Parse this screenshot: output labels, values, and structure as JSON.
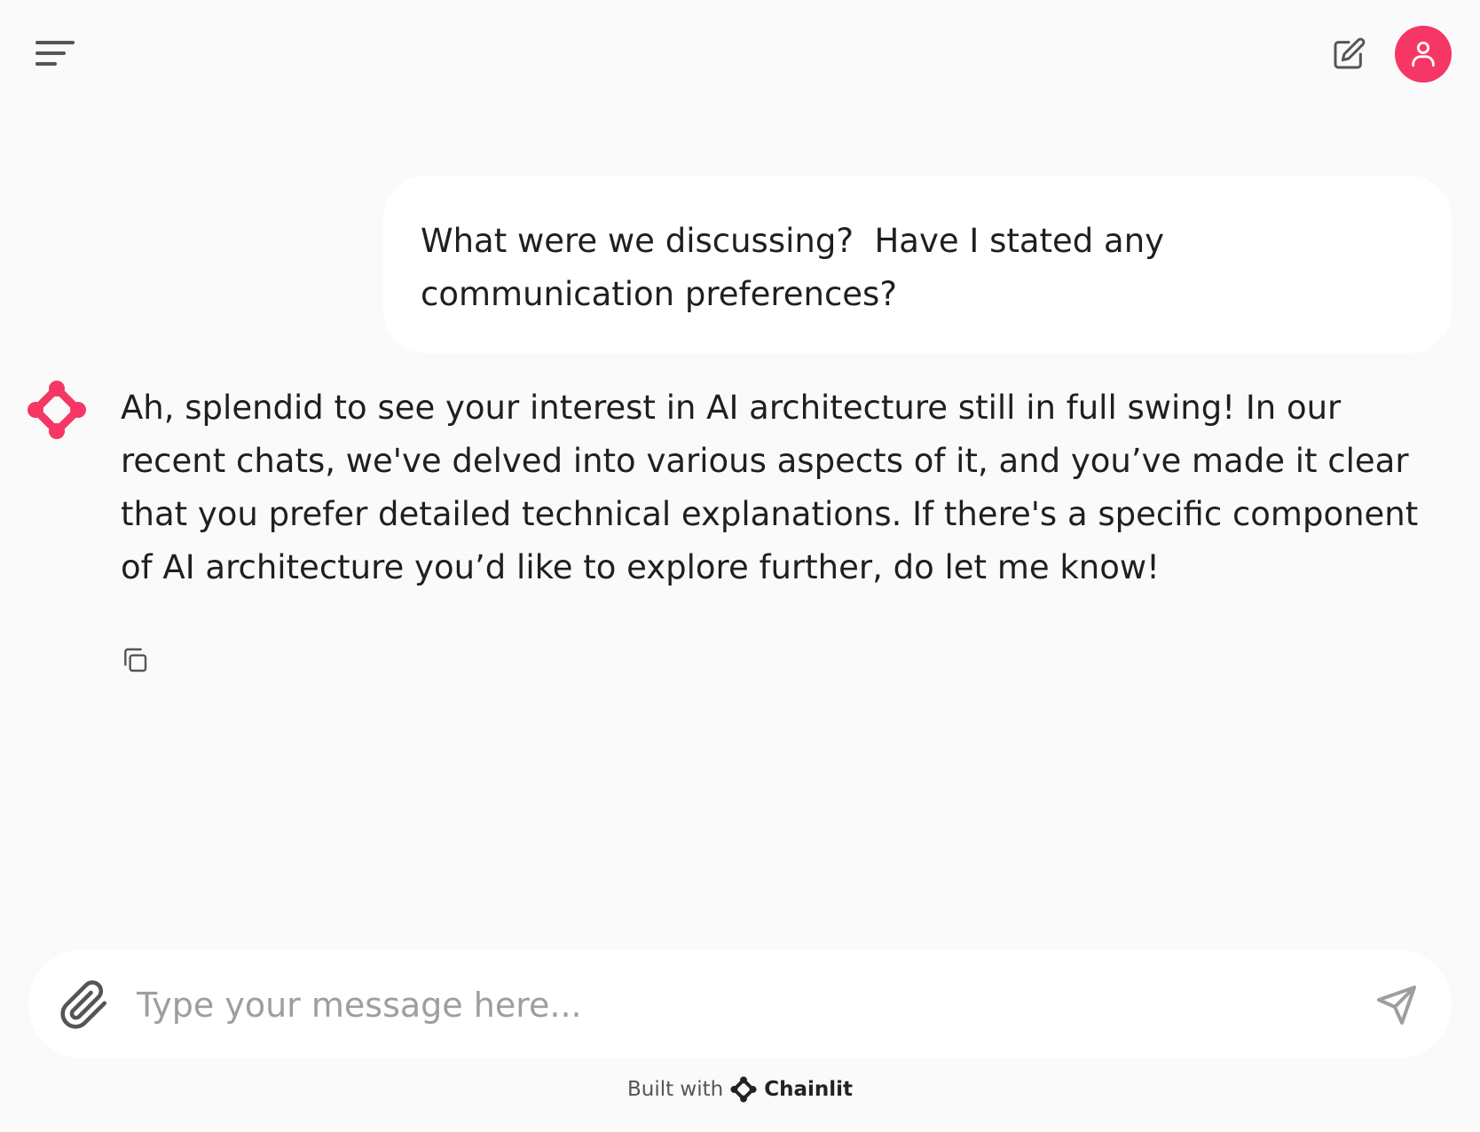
{
  "header": {
    "menu_icon": "menu-lines-icon",
    "new_chat_icon": "edit-square-icon",
    "user_icon": "user-icon",
    "accent_color": "#f63664"
  },
  "messages": [
    {
      "role": "user",
      "text": "What were we discussing?  Have I stated any communication preferences?"
    },
    {
      "role": "assistant",
      "text": "Ah, splendid to see your interest in AI architecture still in full swing! In our recent chats, we've delved into various aspects of it, and you’ve made it clear that you prefer detailed technical explanations. If there's a specific component of AI architecture you’d like to explore further, do let me know!",
      "actions": [
        "copy-icon"
      ]
    }
  ],
  "composer": {
    "placeholder": "Type your message here...",
    "value": "",
    "attach_icon": "paperclip-icon",
    "send_icon": "send-icon"
  },
  "footer": {
    "built_with": "Built with",
    "brand": "Chainlit"
  }
}
